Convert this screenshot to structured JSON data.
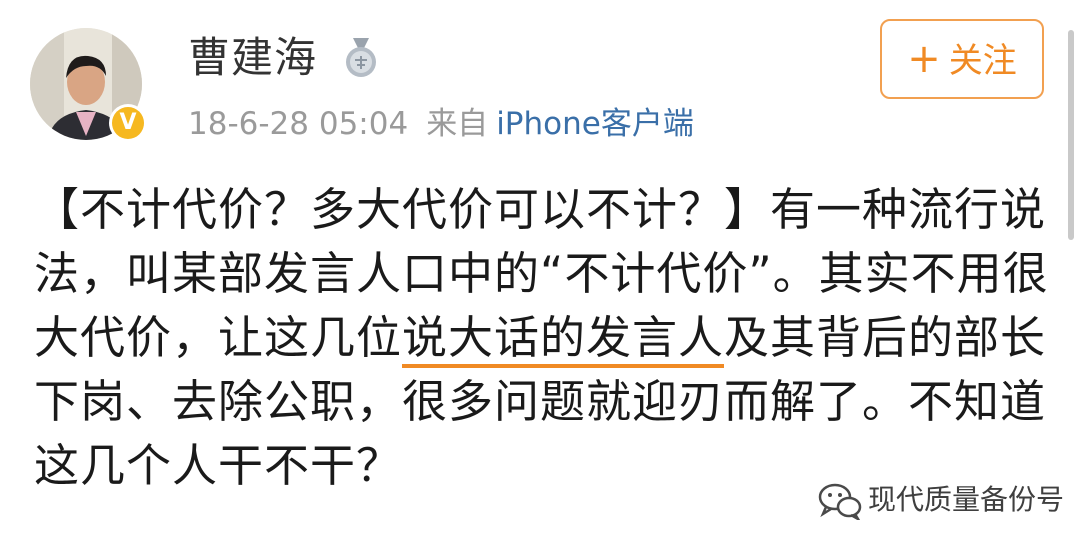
{
  "user": {
    "name": "曹建海",
    "avatar_icon": "profile-photo",
    "medal_icon": "medal-icon",
    "badge_icon": "verified-v-icon",
    "badge_label": "V"
  },
  "post_meta": {
    "timestamp": "18-6-28 05:04",
    "from_label": "来自",
    "client": "iPhone客户端"
  },
  "follow_button": {
    "icon": "+",
    "label": "关注"
  },
  "post": {
    "line1": "【不计代价？多大代价可以不计？】有一种流行说",
    "line2": "法，叫某部发言人口中的“不计代价”。其实不用很",
    "line3_before": "大代价，让这几位",
    "line3_highlight": "说大话的发言人",
    "line3_after": "及其背后的部长",
    "line4": "下岗、去除公职，很多问题就迎刃而解了。不知道",
    "line5": "这几个人干不干？"
  },
  "watermark": {
    "icon": "wechat-icon",
    "text": "现代质量备份号"
  },
  "colors": {
    "accent_orange": "#f08a24",
    "link_blue": "#3a6fa8",
    "meta_gray": "#9a9a9a",
    "badge_yellow": "#f6b820"
  }
}
